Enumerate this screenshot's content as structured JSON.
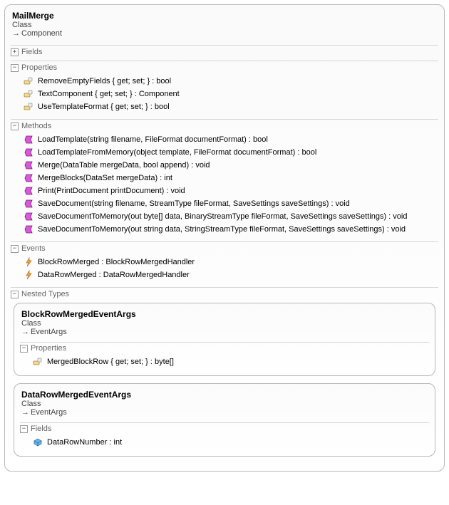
{
  "class": {
    "name": "MailMerge",
    "kind": "Class",
    "base": "Component"
  },
  "sections": {
    "fields": {
      "label": "Fields",
      "collapsed": true
    },
    "properties": {
      "label": "Properties",
      "items": [
        "RemoveEmptyFields { get; set; } : bool",
        "TextComponent { get; set; } : Component",
        "UseTemplateFormat { get; set; } : bool"
      ]
    },
    "methods": {
      "label": "Methods",
      "items": [
        "LoadTemplate(string filename, FileFormat documentFormat) : bool",
        "LoadTemplateFromMemory(object template, FileFormat documentFormat) : bool",
        "Merge(DataTable mergeData, bool append) : void",
        "MergeBlocks(DataSet mergeData) : int",
        "Print(PrintDocument printDocument) : void",
        "SaveDocument(string filename, StreamType fileFormat, SaveSettings saveSettings) : void",
        "SaveDocumentToMemory(out byte[] data, BinaryStreamType fileFormat, SaveSettings saveSettings) : void",
        "SaveDocumentToMemory(out string data, StringStreamType fileFormat, SaveSettings saveSettings) : void"
      ]
    },
    "events": {
      "label": "Events",
      "items": [
        "BlockRowMerged : BlockRowMergedHandler",
        "DataRowMerged : DataRowMergedHandler"
      ]
    },
    "nested": {
      "label": "Nested Types"
    }
  },
  "nested_types": [
    {
      "name": "BlockRowMergedEventArgs",
      "kind": "Class",
      "base": "EventArgs",
      "section_label": "Properties",
      "section_kind": "property",
      "items": [
        "MergedBlockRow { get; set; } : byte[]"
      ]
    },
    {
      "name": "DataRowMergedEventArgs",
      "kind": "Class",
      "base": "EventArgs",
      "section_label": "Fields",
      "section_kind": "field",
      "items": [
        "DataRowNumber : int"
      ]
    }
  ]
}
